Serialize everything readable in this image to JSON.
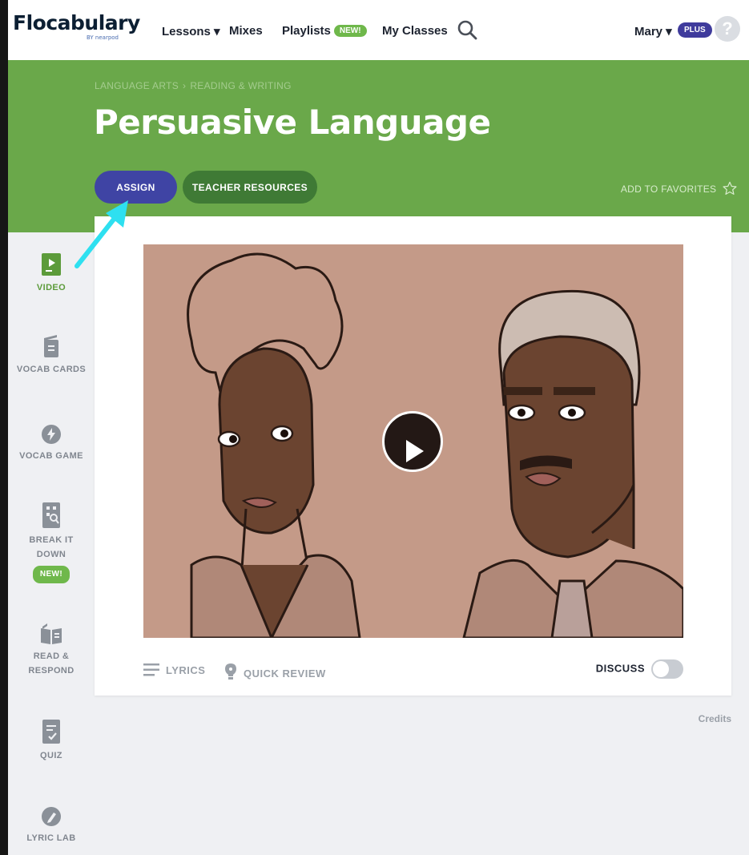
{
  "nav": {
    "logo": "Flocabulary",
    "logo_sub": "BY nearpod",
    "lessons": "Lessons ▾",
    "mixes": "Mixes",
    "playlists": "Playlists",
    "playlists_badge": "NEW!",
    "my_classes": "My Classes",
    "user": "Mary ▾",
    "plan_badge": "PLUS",
    "help": "?"
  },
  "hero": {
    "breadcrumb": [
      "LANGUAGE ARTS",
      "›",
      "READING & WRITING"
    ],
    "title": "Persuasive Language",
    "assign_label": "ASSIGN",
    "resources_label": "TEACHER RESOURCES",
    "favorites_label": "ADD TO FAVORITES"
  },
  "sidebar": {
    "items": [
      {
        "label": "VIDEO",
        "icon": "video-icon",
        "active": true
      },
      {
        "label": "VOCAB CARDS",
        "icon": "vocab-cards-icon"
      },
      {
        "label": "VOCAB GAME",
        "icon": "lightning-icon"
      },
      {
        "label": "BREAK IT DOWN",
        "icon": "break-it-down-icon",
        "badge": "NEW!"
      },
      {
        "label": "READ & RESPOND",
        "icon": "book-icon"
      },
      {
        "label": "QUIZ",
        "icon": "quiz-icon"
      },
      {
        "label": "LYRIC LAB",
        "icon": "pen-icon"
      }
    ]
  },
  "player": {
    "lyrics_label": "LYRICS",
    "quick_review_label": "QUICK REVIEW",
    "discuss_label": "DISCUSS"
  },
  "credits_label": "Credits",
  "colors": {
    "hero_green": "#6aa84a",
    "assign_purple": "#3f44a4",
    "resources_green": "#3f7a35",
    "active_green": "#5c9b3a",
    "annotation_arrow": "#2ee0f0"
  }
}
